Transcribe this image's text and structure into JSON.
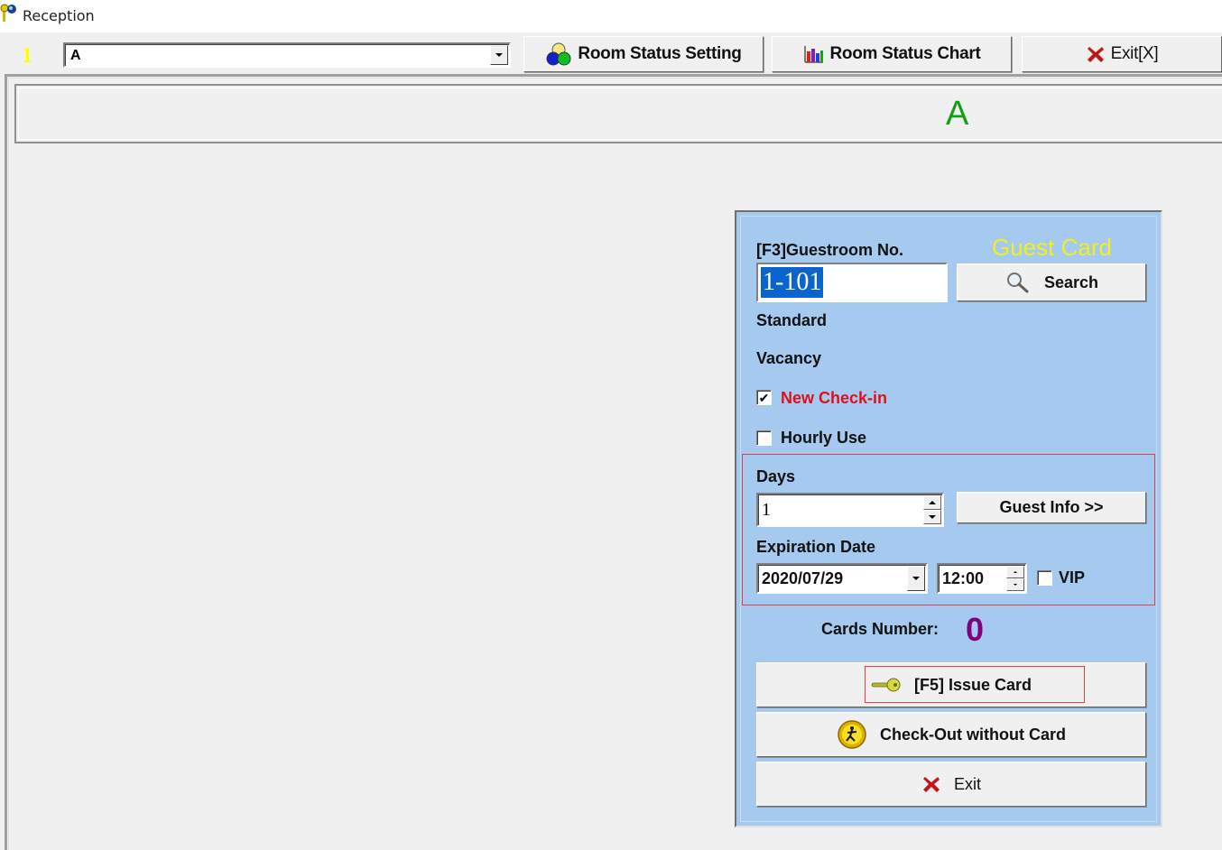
{
  "window": {
    "title": "Reception",
    "icon": "keys-icon"
  },
  "toolbar": {
    "floor_number": "1",
    "building_select": {
      "value": "A"
    },
    "buttons": [
      {
        "label": "Room Status Setting",
        "icon": "three-circles-icon"
      },
      {
        "label": "Room Status Chart",
        "icon": "bar-chart-icon"
      },
      {
        "label": "Exit[X]",
        "icon": "red-x-icon"
      }
    ]
  },
  "banner": {
    "building_name": "A"
  },
  "panel": {
    "guestroom_label": "[F3]Guestroom No.",
    "card_type_title": "Guest Card",
    "room_number": "1-101",
    "search_label": "Search",
    "room_type": "Standard",
    "room_status": "Vacancy",
    "new_checkin": {
      "label": "New Check-in",
      "checked": true
    },
    "hourly_use": {
      "label": "Hourly Use",
      "checked": false
    },
    "days_label": "Days",
    "days_value": "1",
    "guest_info_label": "Guest Info >>",
    "expiration_label": "Expiration Date",
    "expiration_date": "2020/07/29",
    "expiration_time": "12:00",
    "vip": {
      "label": "VIP",
      "checked": false
    },
    "cards_number_label": "Cards Number:",
    "cards_number_value": "0",
    "issue_card_label": "[F5] Issue Card",
    "checkout_label": "Check-Out without Card",
    "exit_label": "Exit"
  },
  "colors": {
    "panel_bg": "#a6c9ef",
    "guest_card_title": "#f0f020",
    "new_checkin_text": "#e0101a",
    "cards_count": "#800080",
    "banner_text": "#14a014",
    "floor_number": "#ffff00",
    "selection": "#0a64d0"
  }
}
